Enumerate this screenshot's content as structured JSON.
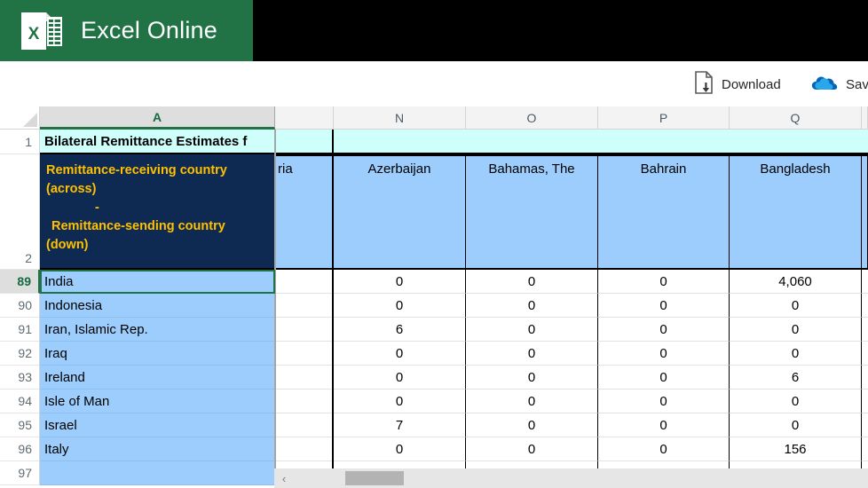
{
  "brand": {
    "title": "Excel Online",
    "logo_icon": "excel-logo-icon",
    "bar_color": "#217346"
  },
  "commandbar": {
    "items": [
      {
        "label": "Download",
        "icon": "document-download-icon"
      },
      {
        "label": "Save",
        "icon": "onedrive-cloud-icon"
      }
    ]
  },
  "grid": {
    "select_all_icon": "select-all-corner-icon",
    "column_headers": [
      {
        "letter": "A",
        "active": true
      },
      {
        "letter": "",
        "active": false
      },
      {
        "letter": "N",
        "active": false
      },
      {
        "letter": "O",
        "active": false
      },
      {
        "letter": "P",
        "active": false
      },
      {
        "letter": "Q",
        "active": false
      }
    ],
    "title_cell": "Bilateral Remittance Estimates f",
    "corner_header": {
      "line1": "Remittance-receiving country",
      "line2": "(across)",
      "line3": "-",
      "line4": "Remittance-sending country",
      "line5": "(down)"
    },
    "country_columns": [
      "ria",
      "Azerbaijan",
      "Bahamas, The",
      "Bahrain",
      "Bangladesh"
    ],
    "rows": [
      {
        "number": "1",
        "active": false
      },
      {
        "number": "2",
        "active": false
      },
      {
        "number": "89",
        "active": true,
        "country": "India",
        "values": [
          "",
          "0",
          "0",
          "0",
          "4,060"
        ]
      },
      {
        "number": "90",
        "active": false,
        "country": "Indonesia",
        "values": [
          "",
          "0",
          "0",
          "0",
          "0"
        ]
      },
      {
        "number": "91",
        "active": false,
        "country": "Iran, Islamic Rep.",
        "values": [
          "",
          "6",
          "0",
          "0",
          "0"
        ]
      },
      {
        "number": "92",
        "active": false,
        "country": "Iraq",
        "values": [
          "",
          "0",
          "0",
          "0",
          "0"
        ]
      },
      {
        "number": "93",
        "active": false,
        "country": "Ireland",
        "values": [
          "",
          "0",
          "0",
          "0",
          "6"
        ]
      },
      {
        "number": "94",
        "active": false,
        "country": "Isle of Man",
        "values": [
          "",
          "0",
          "0",
          "0",
          "0"
        ]
      },
      {
        "number": "95",
        "active": false,
        "country": "Israel",
        "values": [
          "",
          "7",
          "0",
          "0",
          "0"
        ]
      },
      {
        "number": "96",
        "active": false,
        "country": "Italy",
        "values": [
          "",
          "0",
          "0",
          "0",
          "156"
        ]
      },
      {
        "number": "97",
        "active": false,
        "country": "",
        "values": [
          "",
          "",
          "",
          "",
          ""
        ]
      }
    ],
    "scrollbar": {
      "left_arrow": "‹"
    },
    "colors": {
      "header_blue": "#9CCDFC",
      "navy": "#0E2A53",
      "gold": "#FFC000",
      "title_cyan": "#CFFFFB",
      "excel_green": "#217346"
    }
  }
}
